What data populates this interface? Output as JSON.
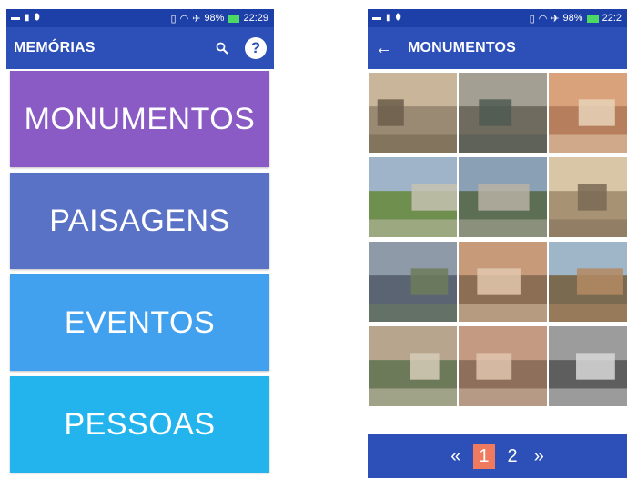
{
  "status_bar": {
    "battery": "98%",
    "time_left": "22:29",
    "time_right": "22:2"
  },
  "left_screen": {
    "title": "MEMÓRIAS",
    "menu": [
      {
        "label": "MONUMENTOS",
        "color": "#8a5bc4"
      },
      {
        "label": "PAISAGENS",
        "color": "#5a72c6"
      },
      {
        "label": "EVENTOS",
        "color": "#42a1ef"
      },
      {
        "label": "PESSOAS",
        "color": "#23b4ee"
      }
    ]
  },
  "right_screen": {
    "title": "MONUMENTOS",
    "photos": [
      {
        "name": "building-with-people"
      },
      {
        "name": "river-with-boat"
      },
      {
        "name": "waterfront-town"
      },
      {
        "name": "school-building"
      },
      {
        "name": "aerial-town-view"
      },
      {
        "name": "parade-march"
      },
      {
        "name": "river-bridge-aerial"
      },
      {
        "name": "girl-on-bicycle"
      },
      {
        "name": "field-with-trees"
      },
      {
        "name": "people-by-building"
      },
      {
        "name": "street-with-car"
      },
      {
        "name": "industrial-interior"
      }
    ],
    "pagination": {
      "prev": "«",
      "pages": [
        "1",
        "2"
      ],
      "active": "1",
      "next": "»"
    }
  },
  "colors": {
    "statusbar": "#1d40a8",
    "appbar": "#2c4fb8",
    "page_active": "#f07a5e"
  }
}
